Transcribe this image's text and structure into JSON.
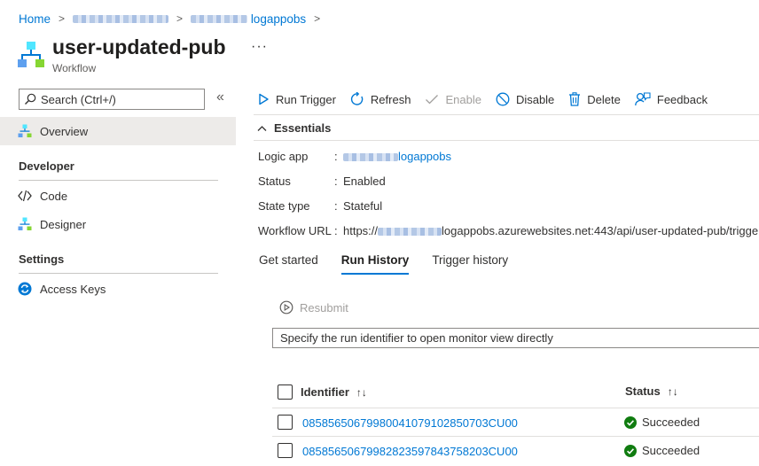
{
  "breadcrumb": {
    "home": "Home",
    "second_suffix": "logappobs"
  },
  "header": {
    "title": "user-updated-pub",
    "subtitle": "Workflow",
    "more": "···"
  },
  "sidebar": {
    "search_placeholder": "Search (Ctrl+/)",
    "collapse": "«",
    "overview": "Overview",
    "groups": [
      {
        "label": "Developer",
        "items": [
          "Code",
          "Designer"
        ]
      },
      {
        "label": "Settings",
        "items": [
          "Access Keys"
        ]
      }
    ]
  },
  "toolbar": {
    "run_trigger": "Run Trigger",
    "refresh": "Refresh",
    "enable": "Enable",
    "disable": "Disable",
    "delete": "Delete",
    "feedback": "Feedback"
  },
  "essentials": {
    "heading": "Essentials",
    "rows": [
      {
        "label": "Logic app",
        "value": "logappobs"
      },
      {
        "label": "Status",
        "value": "Enabled"
      },
      {
        "label": "State type",
        "value": "Stateful"
      },
      {
        "label": "Workflow URL",
        "value_prefix": "https://",
        "value": "logappobs.azurewebsites.net:443/api/user-updated-pub/trigge"
      }
    ]
  },
  "tabs": [
    "Get started",
    "Run History",
    "Trigger history"
  ],
  "run_history": {
    "resubmit": "Resubmit",
    "input_placeholder": "Specify the run identifier to open monitor view directly",
    "columns": {
      "identifier": "Identifier",
      "status": "Status",
      "sort_icon": "↑↓"
    },
    "rows": [
      {
        "id": "08585650679980041079102850703CU00",
        "status": "Succeeded"
      },
      {
        "id": "08585650679982823597843758203CU00",
        "status": "Succeeded"
      }
    ]
  },
  "colors": {
    "accent": "#0078d4",
    "success": "#107c10",
    "selected_nav": "#edebe9"
  }
}
